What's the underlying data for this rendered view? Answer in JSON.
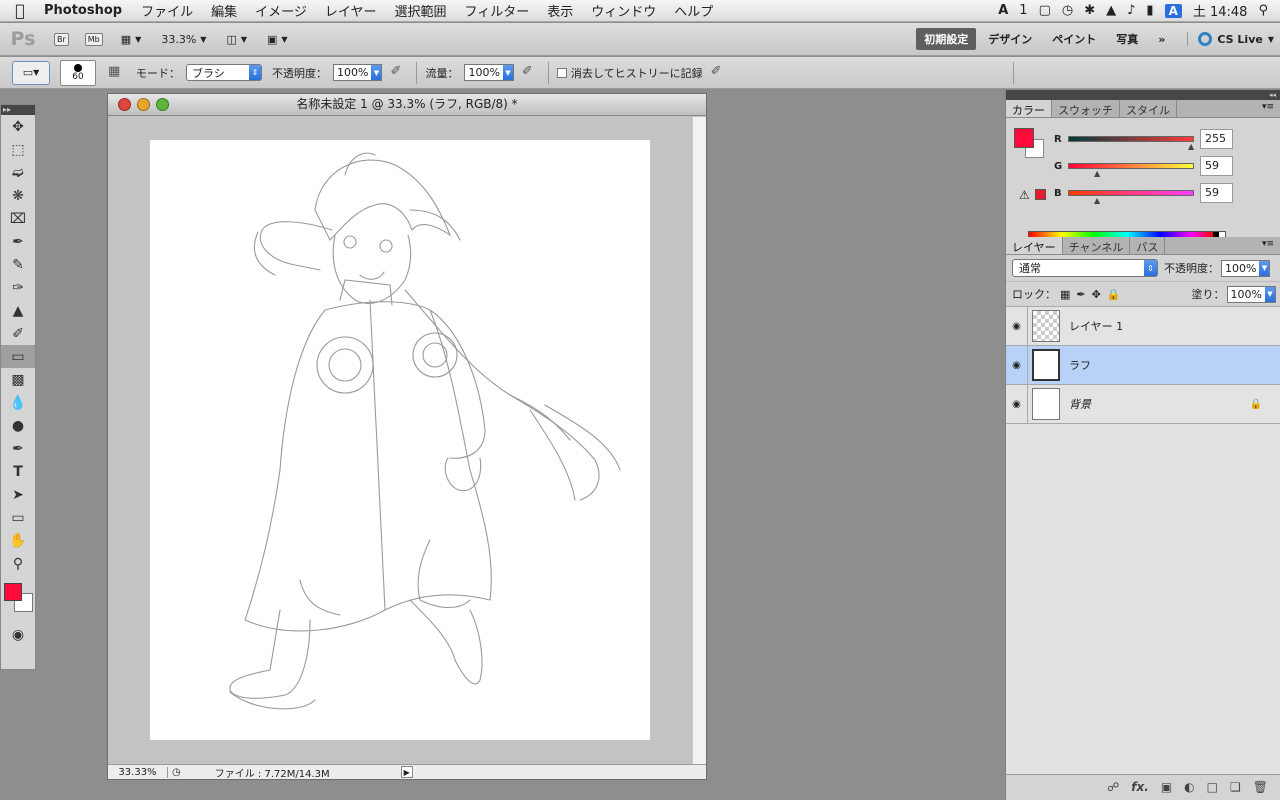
{
  "menubar": {
    "app_name": "Photoshop",
    "menus": [
      "ファイル",
      "編集",
      "イメージ",
      "レイヤー",
      "選択範囲",
      "フィルター",
      "表示",
      "ウィンドウ",
      "ヘルプ"
    ],
    "status_num": "1",
    "ime": "A",
    "clock": "土 14:48"
  },
  "appbar": {
    "logo": "Ps",
    "bridge_label": "Br",
    "mini_bridge_label": "Mb",
    "zoom": "33.3%",
    "workspaces": [
      "初期設定",
      "デザイン",
      "ペイント",
      "写真"
    ],
    "more": "»",
    "cs_live": "CS Live"
  },
  "options": {
    "brush_size": "60",
    "mode_label": "モード：",
    "mode_value": "ブラシ",
    "opacity_label": "不透明度：",
    "opacity_value": "100%",
    "flow_label": "流量：",
    "flow_value": "100%",
    "erase_history_label": "消去してヒストリーに記録"
  },
  "document": {
    "title": "名称未設定 1 @ 33.3% (ラフ, RGB/8) *",
    "status_zoom": "33.33%",
    "status_file": "ファイル : 7.72M/14.3M"
  },
  "color_panel": {
    "tabs": [
      "カラー",
      "スウォッチ",
      "スタイル"
    ],
    "r_label": "R",
    "r_value": "255",
    "g_label": "G",
    "g_value": "59",
    "b_label": "B",
    "b_value": "59",
    "foreground": "#ff0a3b",
    "background": "#ffffff"
  },
  "layers_panel": {
    "tabs": [
      "レイヤー",
      "チャンネル",
      "パス"
    ],
    "blend_mode": "通常",
    "opacity_label": "不透明度：",
    "opacity_value": "100%",
    "lock_label": "ロック：",
    "fill_label": "塗り：",
    "fill_value": "100%",
    "layers": [
      {
        "name": "レイヤー 1",
        "visible": true,
        "selected": false,
        "locked": false
      },
      {
        "name": "ラフ",
        "visible": true,
        "selected": true,
        "locked": false
      },
      {
        "name": "背景",
        "visible": true,
        "selected": false,
        "locked": true
      }
    ]
  },
  "icons": {
    "tools": [
      "move-icon",
      "marquee-icon",
      "lasso-icon",
      "quick-select-icon",
      "crop-icon",
      "eyedropper-icon",
      "healing-brush-icon",
      "brush-icon",
      "clone-stamp-icon",
      "history-brush-icon",
      "eraser-icon",
      "gradient-icon",
      "blur-icon",
      "dodge-icon",
      "pen-icon",
      "type-icon",
      "path-select-icon",
      "shape-icon",
      "hand-icon",
      "zoom-icon"
    ],
    "layer_footer": [
      "link-icon",
      "fx-icon",
      "mask-icon",
      "adjustment-icon",
      "group-icon",
      "new-layer-icon",
      "trash-icon"
    ]
  }
}
